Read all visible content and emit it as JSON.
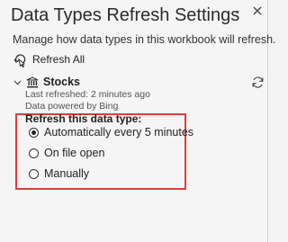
{
  "pane": {
    "title": "Data Types Refresh Settings",
    "subtitle": "Manage how data types in this workbook will refresh.",
    "refresh_all_label": "Refresh All"
  },
  "data_type": {
    "name": "Stocks",
    "last_refreshed": "Last refreshed: 2 minutes ago",
    "powered_by": "Data powered by Bing"
  },
  "refresh_options": {
    "label": "Refresh this data type:",
    "options": [
      {
        "label": "Automatically every 5 minutes",
        "selected": true
      },
      {
        "label": "On file open",
        "selected": false
      },
      {
        "label": "Manually",
        "selected": false
      }
    ]
  },
  "colors": {
    "highlight_border": "#e03c3c",
    "pane_background": "#f5f5f5"
  },
  "icons": {
    "refresh_all": "refresh-all-icon",
    "collapse": "chevron-down-icon",
    "close": "close-icon",
    "data_type": "bank-icon",
    "refresh": "refresh-icon"
  }
}
